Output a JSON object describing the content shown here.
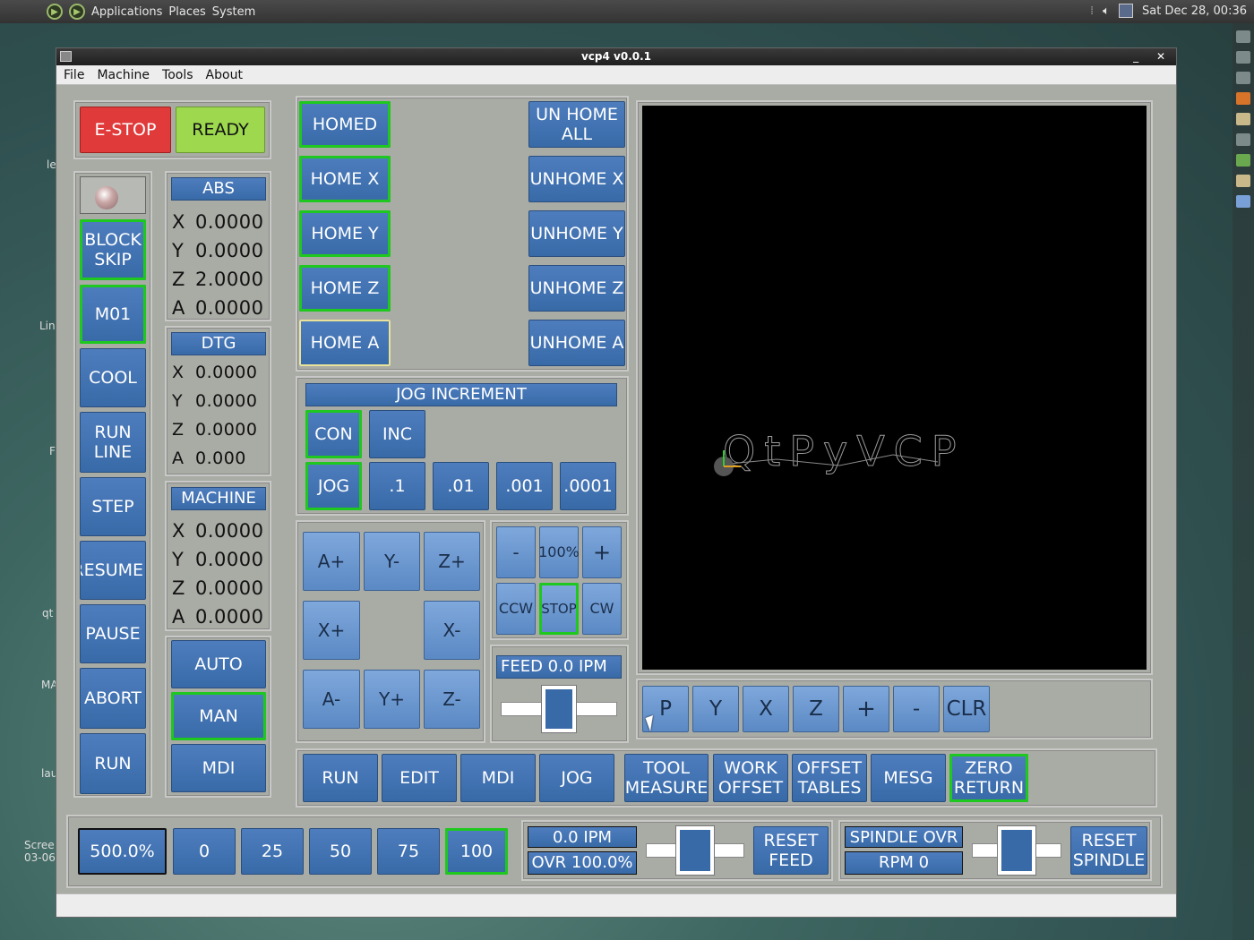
{
  "desktop": {
    "menu": [
      "Applications",
      "Places",
      "System"
    ],
    "clock": "Sat Dec 28, 00:36",
    "side_labels": [
      "le",
      "Lin",
      "F",
      "qt",
      "MA",
      "lau",
      "Scree",
      "03-06"
    ]
  },
  "window": {
    "title": "vcp4 v0.0.1",
    "controls": "_ ✕",
    "menu": [
      "File",
      "Machine",
      "Tools",
      "About"
    ]
  },
  "left_panel": {
    "estop": "E-STOP",
    "ready": "READY",
    "buttons": [
      "BLOCK\nSKIP",
      "M01",
      "COOL",
      "RUN\nLINE",
      "STEP",
      "RESUME",
      "PAUSE",
      "ABORT",
      "RUN"
    ],
    "colors": {
      "estop": "#e03a3a",
      "ready": "#9dd84e",
      "active_outline": "#1ec81e"
    }
  },
  "dro": {
    "abs": {
      "title": "ABS",
      "rows": [
        [
          "X",
          "0.0000"
        ],
        [
          "Y",
          "0.0000"
        ],
        [
          "Z",
          "2.0000"
        ],
        [
          "A",
          "0.0000"
        ]
      ]
    },
    "dtg": {
      "title": "DTG",
      "rows": [
        [
          "X",
          "0.0000"
        ],
        [
          "Y",
          "0.0000"
        ],
        [
          "Z",
          "0.0000"
        ],
        [
          "A",
          "0.000"
        ]
      ]
    },
    "machine": {
      "title": "MACHINE",
      "rows": [
        [
          "X",
          "0.0000"
        ],
        [
          "Y",
          "0.0000"
        ],
        [
          "Z",
          "0.0000"
        ],
        [
          "A",
          "0.0000"
        ]
      ]
    }
  },
  "modes": [
    "AUTO",
    "MAN",
    "MDI"
  ],
  "homing": {
    "home": [
      "HOMED",
      "HOME X",
      "HOME Y",
      "HOME Z",
      "HOME A"
    ],
    "unhome": [
      "UN HOME\nALL",
      "UNHOME X",
      "UNHOME Y",
      "UNHOME Z",
      "UNHOME A"
    ]
  },
  "jog_increment": {
    "title": "JOG INCREMENT",
    "row1": [
      "CON",
      "INC"
    ],
    "row2": [
      "JOG",
      ".1",
      ".01",
      ".001",
      ".0001"
    ]
  },
  "jog_pad": [
    "A+",
    "Y-",
    "Z+",
    "X+",
    "X-",
    "A-",
    "Y+",
    "Z-"
  ],
  "spindle": {
    "minus": "-",
    "pct": "100%",
    "plus": "+",
    "ccw": "CCW",
    "stop": "STOP",
    "cw": "CW"
  },
  "feed": {
    "label": "FEED 0.0  IPM",
    "slider_value": 0.5
  },
  "preview": {
    "logo": "QtPyVCP",
    "view_buttons": [
      "P",
      "Y",
      "X",
      "Z",
      "+",
      "-",
      "CLR"
    ]
  },
  "tabs": [
    "RUN",
    "EDIT",
    "MDI",
    "JOG",
    "TOOL\nMEASURE",
    "WORK\nOFFSET",
    "OFFSET\nTABLES",
    "MESG",
    "ZERO\nRETURN"
  ],
  "rapid": {
    "display": "500.0%",
    "presets": [
      "0",
      "25",
      "50",
      "75",
      "100"
    ]
  },
  "feed_ovr": {
    "ipm": "0.0  IPM",
    "ovr": "OVR 100.0%",
    "reset": "RESET\nFEED",
    "slider_value": 0.5
  },
  "spindle_ovr": {
    "title": "SPINDLE OVR",
    "rpm": "RPM 0",
    "reset": "RESET\nSPINDLE",
    "slider_value": 0.5
  }
}
